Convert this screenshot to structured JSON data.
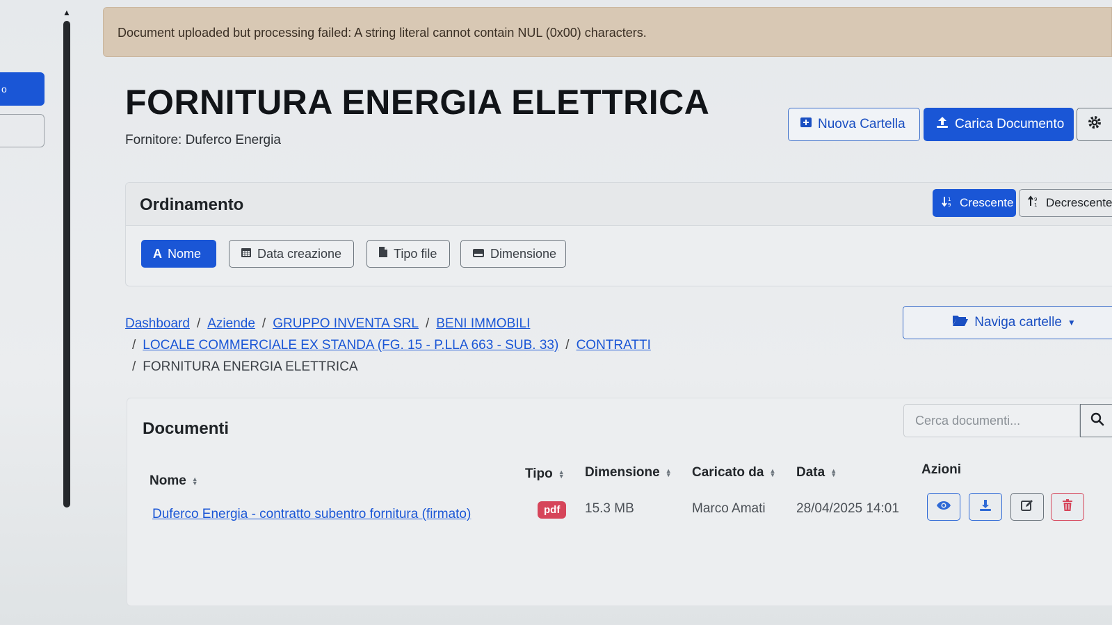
{
  "sidebar": {
    "active_item_label": "o"
  },
  "alert": {
    "message": "Document uploaded but processing failed: A string literal cannot contain NUL (0x00) characters."
  },
  "header": {
    "title": "FORNITURA ENERGIA ELETTRICA",
    "supplier": "Fornitore: Duferco Energia",
    "new_folder_label": "Nuova Cartella",
    "upload_label": "Carica Documento"
  },
  "sorting": {
    "title": "Ordinamento",
    "ascending_label": "Crescente",
    "descending_label": "Decrescente",
    "fields": {
      "name": "Nome",
      "created": "Data creazione",
      "type": "Tipo file",
      "size": "Dimensione"
    },
    "active_field": "Nome",
    "active_direction": "Crescente"
  },
  "breadcrumb": {
    "items": [
      "Dashboard",
      "Aziende",
      "GRUPPO INVENTA SRL",
      "BENI IMMOBILI",
      "LOCALE COMMERCIALE EX STANDA (FG. 15 - P.LLA 663 - SUB. 33)",
      "CONTRATTI"
    ],
    "current": "FORNITURA ENERGIA ELETTRICA",
    "separator": "/"
  },
  "folder_nav": {
    "label": "Naviga cartelle"
  },
  "documents": {
    "title": "Documenti",
    "search_placeholder": "Cerca documenti...",
    "columns": {
      "name": "Nome",
      "type": "Tipo",
      "size": "Dimensione",
      "uploaded_by": "Caricato da",
      "date": "Data",
      "actions": "Azioni"
    },
    "rows": [
      {
        "name": "Duferco Energia - contratto subentro fornitura (firmato)",
        "type": "pdf",
        "size": "15.3 MB",
        "uploaded_by": "Marco Amati",
        "date": "28/04/2025 14:01"
      }
    ]
  },
  "colors": {
    "primary": "#1a56d6",
    "danger": "#d6455a",
    "alert_bg": "#d8c8b4"
  }
}
